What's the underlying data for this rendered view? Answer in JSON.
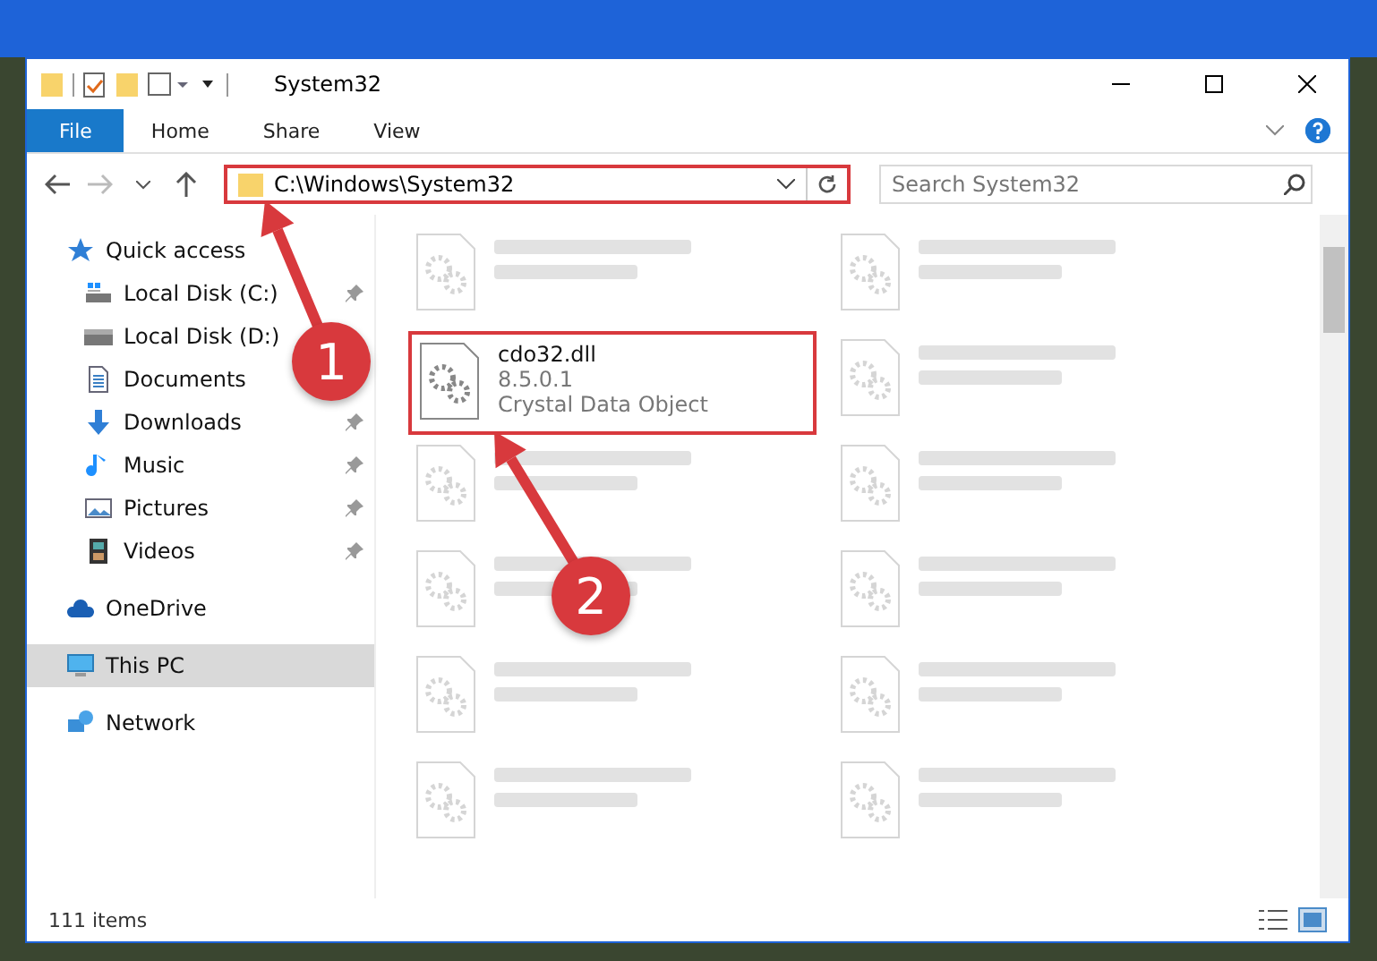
{
  "window": {
    "title": "System32"
  },
  "ribbon_tabs": [
    {
      "label": "File",
      "kind": "menu"
    },
    {
      "label": "Home",
      "kind": "tab"
    },
    {
      "label": "Share",
      "kind": "tab"
    },
    {
      "label": "View",
      "kind": "tab"
    }
  ],
  "address_bar": {
    "path": "C:\\Windows\\System32",
    "highlighted": true
  },
  "search": {
    "placeholder": "Search System32"
  },
  "sidebar": {
    "items": [
      {
        "label": "Quick access",
        "kind": "star",
        "selected": false,
        "pinned": false,
        "children": [
          {
            "label": "Local Disk (C:)",
            "kind": "drive-c",
            "selected": false,
            "pinned": true
          },
          {
            "label": "Local Disk (D:)",
            "kind": "drive",
            "selected": false,
            "pinned": false
          },
          {
            "label": "Documents",
            "kind": "documents",
            "selected": false,
            "pinned": false
          },
          {
            "label": "Downloads",
            "kind": "downloads",
            "selected": false,
            "pinned": true
          },
          {
            "label": "Music",
            "kind": "music",
            "selected": false,
            "pinned": true
          },
          {
            "label": "Pictures",
            "kind": "pictures",
            "selected": false,
            "pinned": true
          },
          {
            "label": "Videos",
            "kind": "videos",
            "selected": false,
            "pinned": true
          }
        ]
      },
      {
        "label": "OneDrive",
        "kind": "cloud",
        "selected": false,
        "pinned": false
      },
      {
        "label": "This PC",
        "kind": "pc",
        "selected": true,
        "pinned": false
      },
      {
        "label": "Network",
        "kind": "network",
        "selected": false,
        "pinned": false
      }
    ]
  },
  "files": [
    {
      "kind": "blurred"
    },
    {
      "kind": "blurred"
    },
    {
      "kind": "file",
      "name": "cdo32.dll",
      "version": "8.5.0.1",
      "description": "Crystal Data Object",
      "highlighted": true
    },
    {
      "kind": "blurred"
    },
    {
      "kind": "blurred"
    },
    {
      "kind": "blurred"
    },
    {
      "kind": "blurred"
    },
    {
      "kind": "blurred"
    },
    {
      "kind": "blurred"
    },
    {
      "kind": "blurred"
    },
    {
      "kind": "blurred"
    },
    {
      "kind": "blurred"
    }
  ],
  "status_bar": {
    "count": "111 items"
  },
  "annotations": [
    {
      "label": "1"
    },
    {
      "label": "2"
    }
  ]
}
